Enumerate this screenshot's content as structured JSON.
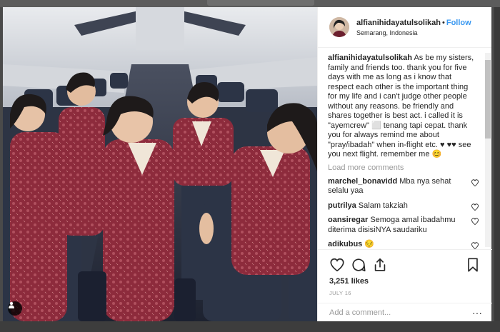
{
  "post": {
    "username": "alfianihidayatulsolikah",
    "follow_label": "Follow",
    "location": "Semarang, Indonesia",
    "caption_user": "alfianihidayatulsolikah",
    "caption_text": "As be my sisters, family and friends too. thank you for five days with me as long as i know that respect each other is the important thing for my life and i can't judge other people without any reasons. be friendly and shares together is best act. i called it is \"ayemcrew\" ⬜ tenang tapi cepat. thank you for always remind me about \"pray/ibadah\" when in-flight etc. ♥ ♥♥ see you next flight. remember me 😊",
    "load_more": "Load more comments",
    "comments": [
      {
        "user": "marchel_bonavidd",
        "text": "Mba nya sehat selalu yaa"
      },
      {
        "user": "putrilya",
        "text": "Salam takziah"
      },
      {
        "user": "oansiregar",
        "text": "Semoga amal ibadahmu diterima disisiNYA saudariku"
      },
      {
        "user": "adikubus",
        "text": "😔"
      }
    ],
    "likes": "3,251 likes",
    "date": "JULY 16",
    "add_comment_placeholder": "Add a comment...",
    "more_options": "···"
  },
  "icons": {
    "like": "heart-icon",
    "comment": "comment-icon",
    "share": "share-icon",
    "save": "bookmark-icon",
    "user_tag": "person-icon"
  },
  "colors": {
    "accent": "#3897f0",
    "text": "#262626",
    "muted": "#999999",
    "uniform": "#8a2a3a"
  }
}
